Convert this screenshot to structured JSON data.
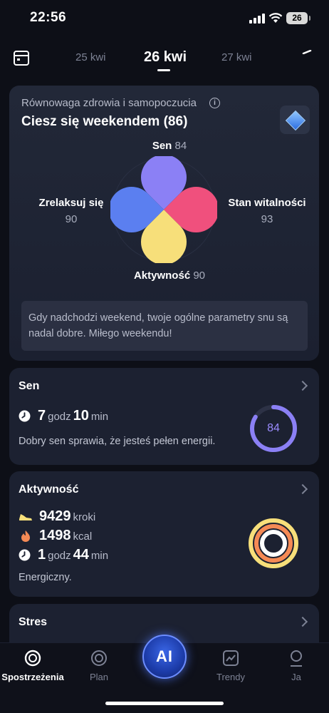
{
  "status_bar": {
    "time": "22:56",
    "battery": "26"
  },
  "date_nav": {
    "prev": "25 kwi",
    "current": "26 kwi",
    "next": "27 kwi"
  },
  "balance": {
    "title": "Równowaga zdrowia i samopoczucia",
    "headline": "Ciesz się weekendem (86)",
    "sleep_label": "Sen",
    "sleep_value": "84",
    "relax_label": "Zrelaksuj się",
    "relax_value": "90",
    "vitality_label": "Stan witalności",
    "vitality_value": "93",
    "activity_label": "Aktywność",
    "activity_value": "90",
    "message": "Gdy nadchodzi weekend, twoje ogólne  parametry snu są nadal dobre. Miłego weekendu!",
    "colors": {
      "sleep": "#8b80f5",
      "relax": "#5b7ff0",
      "vitality": "#f0507d",
      "activity": "#f7df7a"
    }
  },
  "sleep_card": {
    "title": "Sen",
    "hours": "7",
    "hours_unit": "godz",
    "minutes": "10",
    "minutes_unit": "min",
    "description": "Dobry sen sprawia, że jesteś pełen energii.",
    "score": "84",
    "score_fraction": 0.84
  },
  "activity_card": {
    "title": "Aktywność",
    "steps": "9429",
    "steps_unit": "kroki",
    "kcal": "1498",
    "kcal_unit": "kcal",
    "hours": "1",
    "hours_unit": "godz",
    "minutes": "44",
    "minutes_unit": "min",
    "description": "Energiczny."
  },
  "stress_card": {
    "title": "Stres"
  },
  "bottom_nav": {
    "spotlight": "Spostrzeżenia",
    "plan": "Plan",
    "ai": "AI",
    "trends": "Trendy",
    "me": "Ja"
  }
}
